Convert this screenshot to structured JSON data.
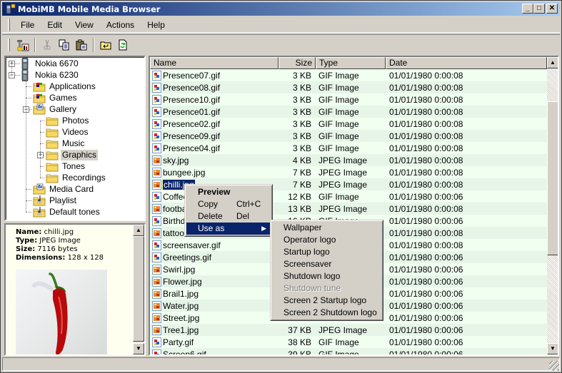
{
  "window": {
    "title": "MobiMB Mobile Media Browser",
    "controls": {
      "minimize": "_",
      "maximize": "□",
      "close": "✕"
    }
  },
  "menubar": {
    "items": [
      {
        "label": "File"
      },
      {
        "label": "Edit"
      },
      {
        "label": "View"
      },
      {
        "label": "Actions"
      },
      {
        "label": "Help"
      }
    ]
  },
  "toolbar": {
    "buttons": [
      {
        "icon": "phone-properties-icon",
        "enabled": true
      },
      {
        "icon": "cut-icon",
        "enabled": false
      },
      {
        "icon": "copy-icon",
        "enabled": true
      },
      {
        "icon": "paste-icon",
        "enabled": true
      },
      {
        "icon": "up-folder-icon",
        "enabled": true
      },
      {
        "icon": "refresh-icon",
        "enabled": true
      }
    ]
  },
  "tree": {
    "nodes": [
      {
        "label": "Nokia 6670",
        "icon": "phone-icon",
        "level": 0,
        "expander": "+"
      },
      {
        "label": "Nokia 6230",
        "icon": "phone-icon",
        "level": 0,
        "expander": "−"
      },
      {
        "label": "Applications",
        "icon": "apps-folder-icon",
        "level": 1
      },
      {
        "label": "Games",
        "icon": "apps-folder-icon",
        "level": 1
      },
      {
        "label": "Gallery",
        "icon": "gallery-folder-icon",
        "level": 1,
        "expander": "−"
      },
      {
        "label": "Photos",
        "icon": "folder-icon",
        "level": 2
      },
      {
        "label": "Videos",
        "icon": "folder-icon",
        "level": 2
      },
      {
        "label": "Music",
        "icon": "folder-icon",
        "level": 2
      },
      {
        "label": "Graphics",
        "icon": "folder-icon",
        "level": 2,
        "expander": "+",
        "selected": true
      },
      {
        "label": "Tones",
        "icon": "folder-icon",
        "level": 2
      },
      {
        "label": "Recordings",
        "icon": "folder-icon",
        "level": 2
      },
      {
        "label": "Media Card",
        "icon": "gallery-folder-icon",
        "level": 1
      },
      {
        "label": "Playlist",
        "icon": "music-folder-icon",
        "level": 1
      },
      {
        "label": "Default tones",
        "icon": "music-folder-icon",
        "level": 1
      }
    ]
  },
  "info": {
    "name_label": "Name:",
    "name": "chilli.jpg",
    "type_label": "Type:",
    "type": "JPEG Image",
    "size_label": "Size:",
    "size": "7116 bytes",
    "dimensions_label": "Dimensions:",
    "dimensions": "128 x 128"
  },
  "list": {
    "columns": [
      "Name",
      "Size",
      "Type",
      "Date"
    ],
    "rows": [
      {
        "name": "Presence07.gif",
        "size": "3 KB",
        "type": "GIF Image",
        "date": "01/01/1980 0:00:08",
        "kind": "gif"
      },
      {
        "name": "Presence08.gif",
        "size": "3 KB",
        "type": "GIF Image",
        "date": "01/01/1980 0:00:08",
        "kind": "gif"
      },
      {
        "name": "Presence10.gif",
        "size": "3 KB",
        "type": "GIF Image",
        "date": "01/01/1980 0:00:08",
        "kind": "gif"
      },
      {
        "name": "Presence01.gif",
        "size": "3 KB",
        "type": "GIF Image",
        "date": "01/01/1980 0:00:08",
        "kind": "gif"
      },
      {
        "name": "Presence02.gif",
        "size": "3 KB",
        "type": "GIF Image",
        "date": "01/01/1980 0:00:08",
        "kind": "gif"
      },
      {
        "name": "Presence09.gif",
        "size": "3 KB",
        "type": "GIF Image",
        "date": "01/01/1980 0:00:08",
        "kind": "gif"
      },
      {
        "name": "Presence04.gif",
        "size": "3 KB",
        "type": "GIF Image",
        "date": "01/01/1980 0:00:08",
        "kind": "gif"
      },
      {
        "name": "sky.jpg",
        "size": "4 KB",
        "type": "JPEG Image",
        "date": "01/01/1980 0:00:08",
        "kind": "jpg"
      },
      {
        "name": "bungee.jpg",
        "size": "7 KB",
        "type": "JPEG Image",
        "date": "01/01/1980 0:00:08",
        "kind": "jpg"
      },
      {
        "name": "chilli.jpg",
        "size": "7 KB",
        "type": "JPEG Image",
        "date": "01/01/1980 0:00:08",
        "kind": "jpg",
        "selected": true
      },
      {
        "name": "Coffee",
        "size": "12 KB",
        "type": "GIF Image",
        "date": "01/01/1980 0:00:06",
        "kind": "gif"
      },
      {
        "name": "footba",
        "size": "13 KB",
        "type": "JPEG Image",
        "date": "01/01/1980 0:00:08",
        "kind": "jpg"
      },
      {
        "name": "Birthd",
        "size": "16 KB",
        "type": "GIF Image",
        "date": "01/01/1980 0:00:06",
        "kind": "gif"
      },
      {
        "name": "tattoo",
        "size": "",
        "type": "",
        "date": "01/01/1980 0:00:08",
        "kind": "jpg"
      },
      {
        "name": "screensaver.gif",
        "size": "",
        "type": "",
        "date": "01/01/1980 0:00:08",
        "kind": "gif"
      },
      {
        "name": "Greetings.gif",
        "size": "",
        "type": "",
        "date": "01/01/1980 0:00:06",
        "kind": "gif"
      },
      {
        "name": "Swirl.jpg",
        "size": "",
        "type": "",
        "date": "01/01/1980 0:00:06",
        "kind": "jpg"
      },
      {
        "name": "Flower.jpg",
        "size": "",
        "type": "",
        "date": "01/01/1980 0:00:06",
        "kind": "jpg"
      },
      {
        "name": "Brail1.jpg",
        "size": "",
        "type": "",
        "date": "01/01/1980 0:00:06",
        "kind": "jpg"
      },
      {
        "name": "Water.jpg",
        "size": "",
        "type": "",
        "date": "01/01/1980 0:00:06",
        "kind": "jpg"
      },
      {
        "name": "Street.jpg",
        "size": "",
        "type": "",
        "date": "01/01/1980 0:00:06",
        "kind": "jpg"
      },
      {
        "name": "Tree1.jpg",
        "size": "37 KB",
        "type": "JPEG Image",
        "date": "01/01/1980 0:00:06",
        "kind": "jpg"
      },
      {
        "name": "Party.gif",
        "size": "38 KB",
        "type": "GIF Image",
        "date": "01/01/1980 0:00:06",
        "kind": "gif"
      },
      {
        "name": "Screen6.gif",
        "size": "39 KB",
        "type": "GIF Image",
        "date": "01/01/1980 0:00:06",
        "kind": "gif"
      }
    ]
  },
  "context_menu": {
    "items": [
      {
        "label": "Preview",
        "bold": true
      },
      {
        "label": "Copy",
        "shortcut": "Ctrl+C"
      },
      {
        "label": "Delete",
        "shortcut": "Del"
      },
      {
        "label": "Use as",
        "submenu": true,
        "highlighted": true
      }
    ]
  },
  "submenu": {
    "items": [
      {
        "label": "Wallpaper"
      },
      {
        "label": "Operator logo"
      },
      {
        "label": "Startup logo"
      },
      {
        "label": "Screensaver"
      },
      {
        "label": "Shutdown logo"
      },
      {
        "label": "Shutdown tune",
        "disabled": true
      },
      {
        "label": "Screen 2 Startup logo"
      },
      {
        "label": "Screen 2 Shutdown logo"
      }
    ]
  },
  "colors": {
    "titlebar_start": "#0a246a",
    "titlebar_end": "#a6caf0",
    "selection": "#0a246a",
    "row_odd": "#f0fff0",
    "row_even": "#e6f5e8",
    "info_bg": "#fffff0"
  }
}
